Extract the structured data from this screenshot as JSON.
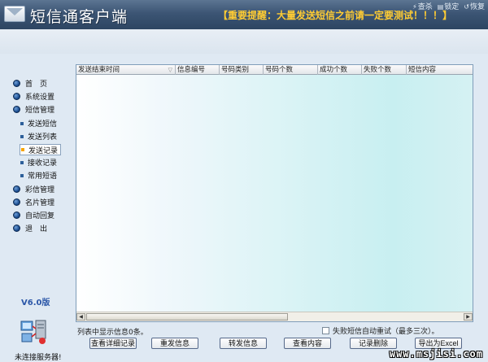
{
  "header": {
    "title": "短信通客户端",
    "notice": "【重要提醒：大量发送短信之前请一定要测试！！！】",
    "controls": [
      {
        "label": "查杀",
        "icon": "kill-icon"
      },
      {
        "label": "锁定",
        "icon": "lock-icon"
      },
      {
        "label": "恢复",
        "icon": "restore-icon"
      }
    ]
  },
  "sidebar": {
    "items": [
      {
        "label": "首　页"
      },
      {
        "label": "系统设置"
      },
      {
        "label": "短信管理"
      },
      {
        "label": "发送短信"
      },
      {
        "label": "发送列表"
      },
      {
        "label": "发送记录"
      },
      {
        "label": "接收记录"
      },
      {
        "label": "常用短语"
      },
      {
        "label": "彩信管理"
      },
      {
        "label": "名片管理"
      },
      {
        "label": "自动回复"
      },
      {
        "label": "退　出"
      }
    ],
    "version": "V6.0版",
    "server_status": "未连接服务器!"
  },
  "table": {
    "columns": [
      "发送结束时间",
      "信息编号",
      "号码类别",
      "号码个数",
      "成功个数",
      "失败个数",
      "短信内容"
    ],
    "rows": []
  },
  "footer": {
    "list_count": "列表中显示信息0条。",
    "retry_label": "失败短信自动重试（最多三次）。",
    "retry_checked": false,
    "buttons": [
      "查看详细记录",
      "重发信息",
      "转发信息",
      "查看内容",
      "记录删除",
      "导出为Excel"
    ]
  },
  "watermark": "www.msjisi.com"
}
